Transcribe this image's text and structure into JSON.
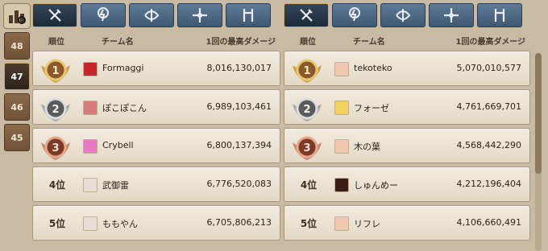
{
  "week_tabs": [
    {
      "label": "48",
      "active": false
    },
    {
      "label": "47",
      "active": true
    },
    {
      "label": "46",
      "active": false
    },
    {
      "label": "45",
      "active": false
    }
  ],
  "category_tabs": [
    "sword-icon",
    "lightning-icon",
    "bow-icon",
    "cross-icon",
    "staff-icon"
  ],
  "columns": {
    "rank": "順位",
    "team": "チーム名",
    "damage": "1回の最高ダメージ"
  },
  "left_panel": {
    "rows": [
      {
        "rank": "1",
        "rank_label": "",
        "team": "Formaggi",
        "damage": "8,016,130,017",
        "icon_color": "#c4242a"
      },
      {
        "rank": "2",
        "rank_label": "",
        "team": "ぽこぽこん",
        "damage": "6,989,103,461",
        "icon_color": "#d87b7b"
      },
      {
        "rank": "3",
        "rank_label": "",
        "team": "Crybell",
        "damage": "6,800,137,394",
        "icon_color": "#e87ac2"
      },
      {
        "rank": "4",
        "rank_label": "4位",
        "team": "武御雷",
        "damage": "6,776,520,083",
        "icon_color": "#e7dfd3"
      },
      {
        "rank": "5",
        "rank_label": "5位",
        "team": "ももやん",
        "damage": "6,705,806,213",
        "icon_color": "#e7dfd3"
      }
    ]
  },
  "right_panel": {
    "rows": [
      {
        "rank": "1",
        "rank_label": "",
        "team": "tekoteko",
        "damage": "5,070,010,577",
        "icon_color": "#f0c8b0"
      },
      {
        "rank": "2",
        "rank_label": "",
        "team": "フォーゼ",
        "damage": "4,761,669,701",
        "icon_color": "#f4d25a"
      },
      {
        "rank": "3",
        "rank_label": "",
        "team": "木の葉",
        "damage": "4,568,442,290",
        "icon_color": "#f0c8b0"
      },
      {
        "rank": "4",
        "rank_label": "4位",
        "team": "しゅんめー",
        "damage": "4,212,196,404",
        "icon_color": "#3a1d14"
      },
      {
        "rank": "5",
        "rank_label": "5位",
        "team": "リフレ",
        "damage": "4,106,660,491",
        "icon_color": "#f0c8b0"
      }
    ]
  }
}
